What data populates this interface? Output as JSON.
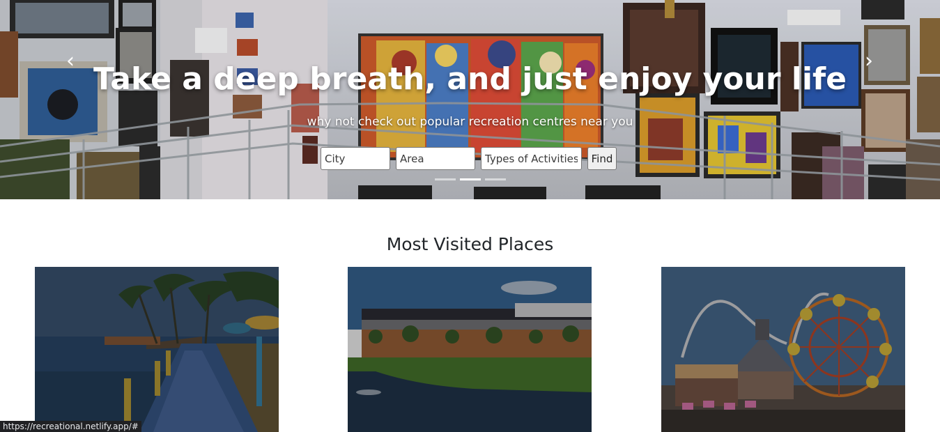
{
  "hero": {
    "title": "Take a deep breath, and just enjoy your life",
    "subtitle": "why not check out popular recreation centres near you",
    "prev_icon": "chevron-left-icon",
    "next_icon": "chevron-right-icon",
    "prev_glyph": "‹",
    "next_glyph": "›",
    "search": {
      "city_placeholder": "City",
      "area_placeholder": "Area",
      "activities_placeholder": "Types of Activities",
      "find_label": "Find"
    },
    "slides": 3,
    "active_slide": 2
  },
  "section": {
    "title": "Most Visited Places"
  },
  "status_bar": {
    "url": "https://recreational.netlify.app/#"
  }
}
